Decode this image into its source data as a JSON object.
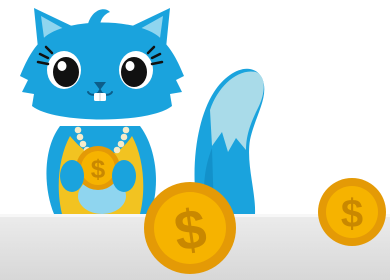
{
  "scene": {
    "character": "blue-cat-mascot",
    "coin_symbol": "$"
  },
  "colors": {
    "fur": "#1aa3dd",
    "fur_shade": "#0c7fb8",
    "fur_light": "#8fd5ef",
    "tail_light": "#a9dbe9",
    "vest": "#f2c321",
    "beads": "#f6eccb",
    "coin_outer": "#e49a06",
    "coin_inner": "#f6b300",
    "coin_symbol": "#c98800",
    "counter": "#e0e0e0"
  }
}
